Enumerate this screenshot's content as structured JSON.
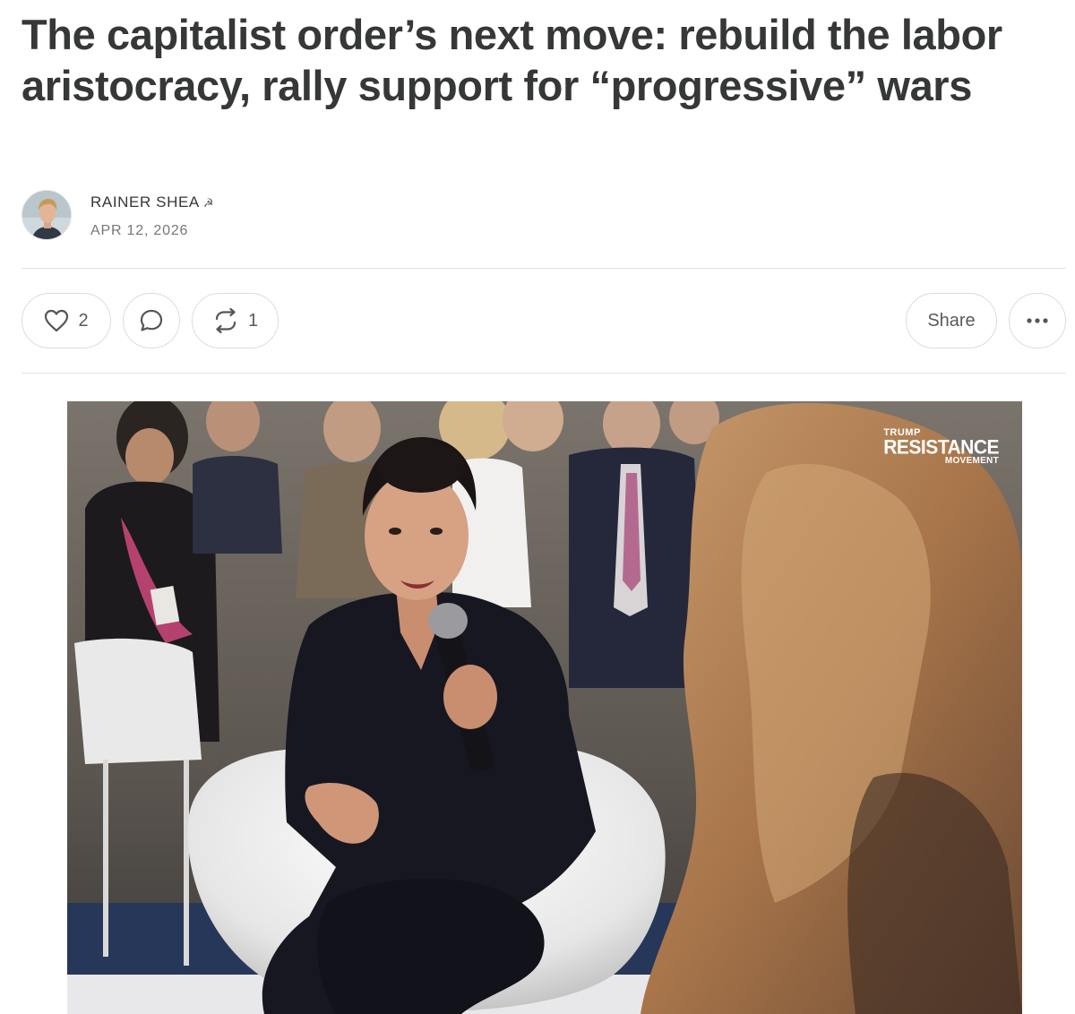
{
  "post": {
    "title": "The capitalist order’s next move: rebuild the labor aristocracy, rally support for “progressive” wars",
    "author": "RAINER SHEA",
    "author_symbol": "☭",
    "date": "APR 12, 2026"
  },
  "actions": {
    "like_icon": "heart-icon",
    "like_count": "2",
    "comment_icon": "comment-bubble-icon",
    "restack_icon": "restack-icon",
    "restack_count": "1",
    "share_label": "Share",
    "more_icon": "ellipsis-icon"
  },
  "hero_image": {
    "watermark_line1": "TRUMP",
    "watermark_line2": "RESISTANCE",
    "watermark_line3": "MOVEMENT"
  }
}
